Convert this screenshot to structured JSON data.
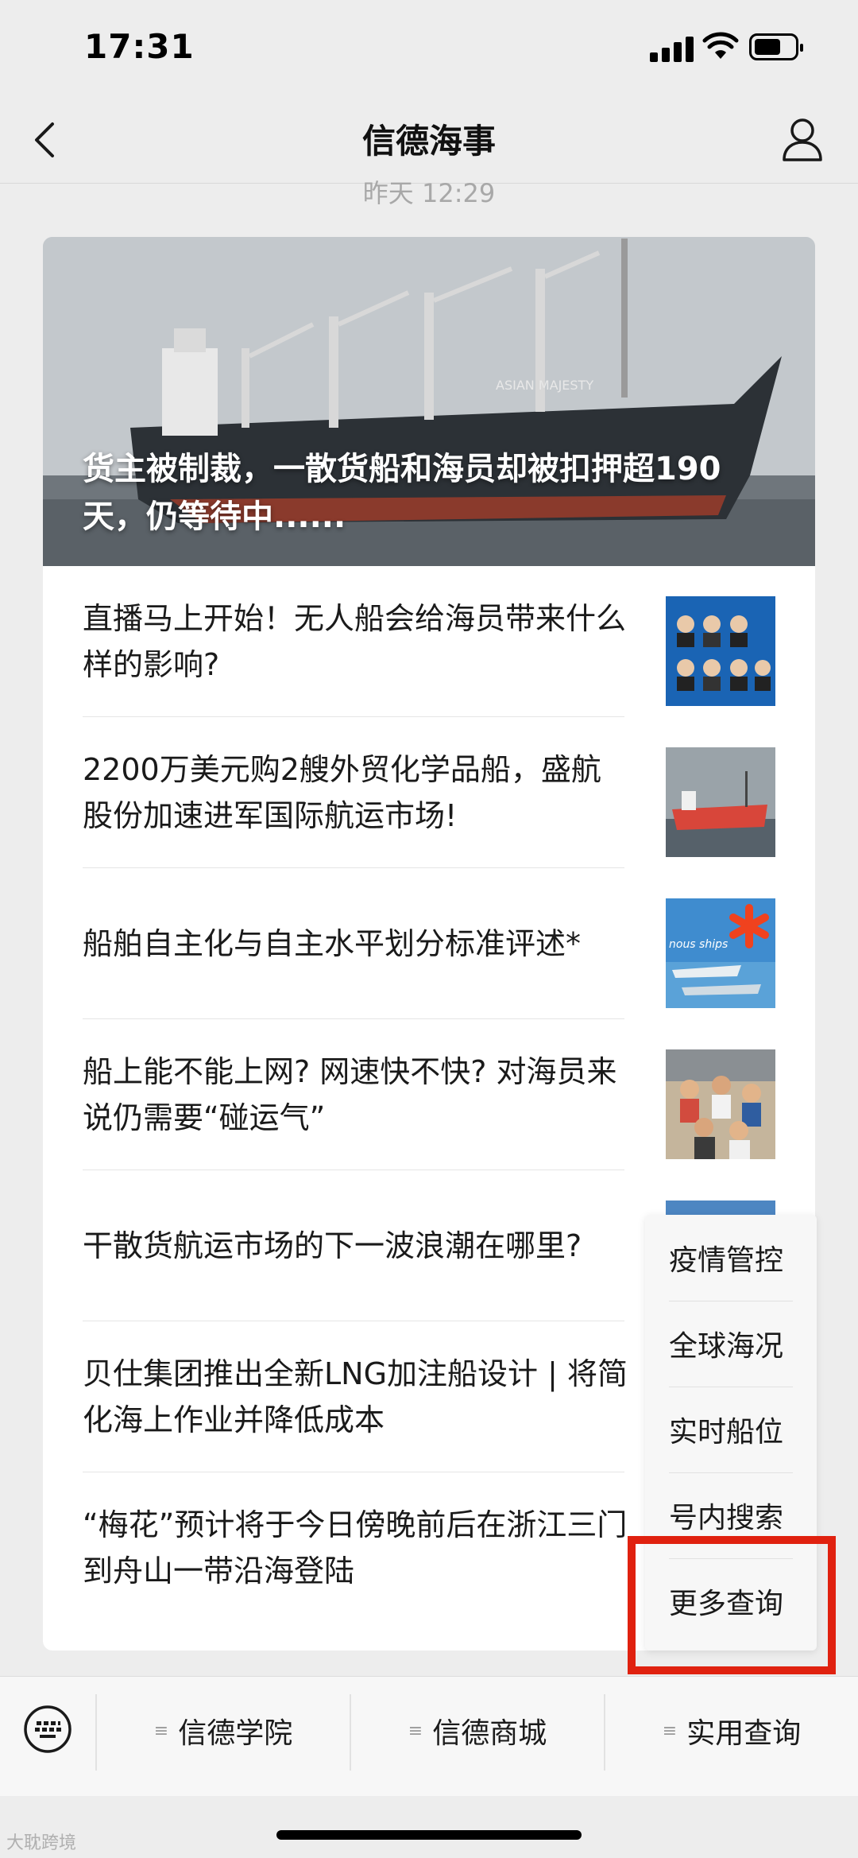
{
  "status_bar": {
    "time": "17:31"
  },
  "nav": {
    "title": "信德海事"
  },
  "timestamp": "昨天 12:29",
  "hero": {
    "title": "货主被制裁，一散货船和海员却被扣押超190天，仍等待中......",
    "ship_name_text": "ASIAN MAJESTY"
  },
  "articles": [
    {
      "title": "直播马上开始！无人船会给海员带来什么样的影响?"
    },
    {
      "title": "2200万美元购2艘外贸化学品船，盛航股份加速进军国际航运市场!"
    },
    {
      "title": "船舶自主化与自主水平划分标准评述*"
    },
    {
      "title": "船上能不能上网? 网速快不快? 对海员来说仍需要“碰运气”"
    },
    {
      "title": "干散货航运市场的下一波浪潮在哪里?"
    },
    {
      "title": "贝仕集团推出全新LNG加注船设计 | 将简化海上作业并降低成本"
    },
    {
      "title": "“梅花”预计将于今日傍晚前后在浙江三门到舟山一带沿海登陆"
    }
  ],
  "thumbnails": {
    "thumb3_text": "nous ships"
  },
  "popup_menu": {
    "items": [
      "疫情管控",
      "全球海况",
      "实时船位",
      "号内搜索",
      "更多查询"
    ]
  },
  "tabbar": {
    "tabs": [
      "信德学院",
      "信德商城",
      "实用查询"
    ],
    "menu_glyph": "≡"
  },
  "watermark": "大耽跨境",
  "colors": {
    "highlight": "#e0210f",
    "background": "#ededed"
  }
}
